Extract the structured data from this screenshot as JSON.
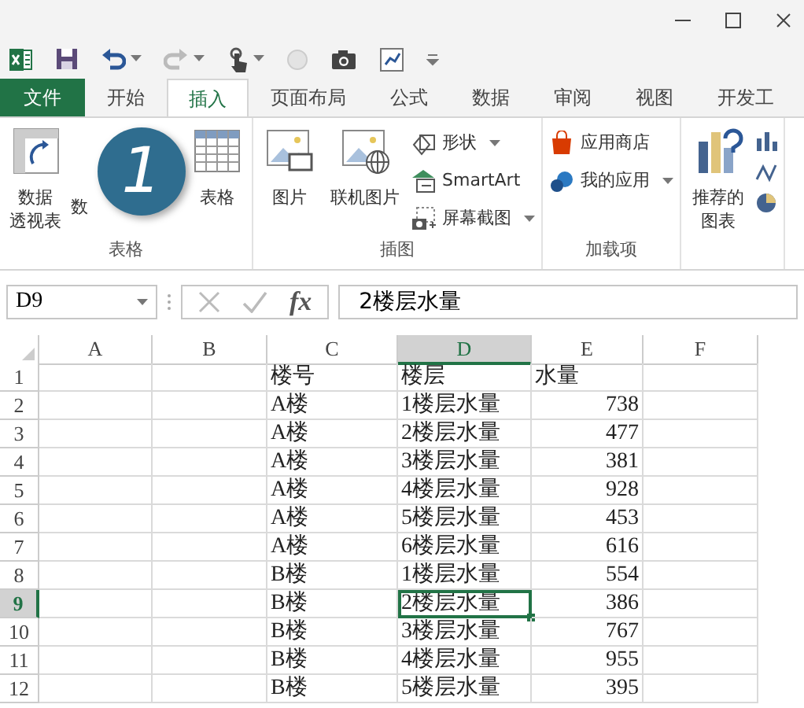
{
  "tabs": [
    {
      "label": "文件",
      "kind": "file",
      "selected": false
    },
    {
      "label": "开始",
      "kind": "tab",
      "selected": false
    },
    {
      "label": "插入",
      "kind": "tab",
      "selected": true
    },
    {
      "label": "页面布局",
      "kind": "tab",
      "selected": false
    },
    {
      "label": "公式",
      "kind": "tab",
      "selected": false
    },
    {
      "label": "数据",
      "kind": "tab",
      "selected": false
    },
    {
      "label": "审阅",
      "kind": "tab",
      "selected": false
    },
    {
      "label": "视图",
      "kind": "tab",
      "selected": false
    },
    {
      "label": "开发工",
      "kind": "tab",
      "selected": false
    }
  ],
  "ribbon": {
    "groups": [
      {
        "label": "表格",
        "items": [
          {
            "kind": "large",
            "lines": [
              "数据",
              "透视表"
            ]
          },
          {
            "kind": "large",
            "lines": [
              "数"
            ]
          },
          {
            "kind": "large",
            "lines": [
              "表格"
            ]
          }
        ]
      },
      {
        "label": "插图",
        "items": [
          {
            "kind": "large",
            "lines": [
              "图片"
            ]
          },
          {
            "kind": "large",
            "lines": [
              "联机图片"
            ]
          },
          {
            "kind": "stack",
            "items": [
              {
                "label": "形状",
                "dropdown": true
              },
              {
                "label": "SmartArt",
                "dropdown": false
              },
              {
                "label": "屏幕截图",
                "dropdown": true
              }
            ]
          }
        ]
      },
      {
        "label": "加载项",
        "items": [
          {
            "kind": "stack",
            "items": [
              {
                "label": "应用商店",
                "dropdown": false
              },
              {
                "label": "我的应用",
                "dropdown": true
              }
            ]
          }
        ]
      },
      {
        "items": [
          {
            "kind": "large",
            "lines": [
              "推荐的",
              "图表"
            ]
          },
          {
            "kind": "icons"
          }
        ]
      }
    ]
  },
  "callout": {
    "number": "1"
  },
  "formula_bar": {
    "name_box": "D9",
    "function_label": "fx",
    "value": "2楼层水量"
  },
  "sheet": {
    "columns": [
      {
        "label": "A",
        "selected": false
      },
      {
        "label": "B",
        "selected": false
      },
      {
        "label": "C",
        "selected": false
      },
      {
        "label": "D",
        "selected": true
      },
      {
        "label": "E",
        "selected": false
      },
      {
        "label": "F",
        "selected": false
      }
    ],
    "rows": [
      {
        "label": "1",
        "selected": false,
        "cells": [
          {
            "value": "楼号",
            "kind": "text",
            "selected": false
          },
          {
            "value": "楼层",
            "kind": "text",
            "selected": false
          },
          {
            "value": "水量",
            "kind": "text",
            "selected": false
          }
        ]
      },
      {
        "label": "2",
        "selected": false,
        "cells": [
          {
            "value": "A楼",
            "kind": "text",
            "selected": false
          },
          {
            "value": "1楼层水量",
            "kind": "text",
            "selected": false
          },
          {
            "value": "738",
            "kind": "number",
            "selected": false
          }
        ]
      },
      {
        "label": "3",
        "selected": false,
        "cells": [
          {
            "value": "A楼",
            "kind": "text",
            "selected": false
          },
          {
            "value": "2楼层水量",
            "kind": "text",
            "selected": false
          },
          {
            "value": "477",
            "kind": "number",
            "selected": false
          }
        ]
      },
      {
        "label": "4",
        "selected": false,
        "cells": [
          {
            "value": "A楼",
            "kind": "text",
            "selected": false
          },
          {
            "value": "3楼层水量",
            "kind": "text",
            "selected": false
          },
          {
            "value": "381",
            "kind": "number",
            "selected": false
          }
        ]
      },
      {
        "label": "5",
        "selected": false,
        "cells": [
          {
            "value": "A楼",
            "kind": "text",
            "selected": false
          },
          {
            "value": "4楼层水量",
            "kind": "text",
            "selected": false
          },
          {
            "value": "928",
            "kind": "number",
            "selected": false
          }
        ]
      },
      {
        "label": "6",
        "selected": false,
        "cells": [
          {
            "value": "A楼",
            "kind": "text",
            "selected": false
          },
          {
            "value": "5楼层水量",
            "kind": "text",
            "selected": false
          },
          {
            "value": "453",
            "kind": "number",
            "selected": false
          }
        ]
      },
      {
        "label": "7",
        "selected": false,
        "cells": [
          {
            "value": "A楼",
            "kind": "text",
            "selected": false
          },
          {
            "value": "6楼层水量",
            "kind": "text",
            "selected": false
          },
          {
            "value": "616",
            "kind": "number",
            "selected": false
          }
        ]
      },
      {
        "label": "8",
        "selected": false,
        "cells": [
          {
            "value": "B楼",
            "kind": "text",
            "selected": false
          },
          {
            "value": "1楼层水量",
            "kind": "text",
            "selected": false
          },
          {
            "value": "554",
            "kind": "number",
            "selected": false
          }
        ]
      },
      {
        "label": "9",
        "selected": true,
        "cells": [
          {
            "value": "B楼",
            "kind": "text",
            "selected": false
          },
          {
            "value": "2楼层水量",
            "kind": "text",
            "selected": true
          },
          {
            "value": "386",
            "kind": "number",
            "selected": false
          }
        ]
      },
      {
        "label": "10",
        "selected": false,
        "cells": [
          {
            "value": "B楼",
            "kind": "text",
            "selected": false
          },
          {
            "value": "3楼层水量",
            "kind": "text",
            "selected": false
          },
          {
            "value": "767",
            "kind": "number",
            "selected": false
          }
        ]
      },
      {
        "label": "11",
        "selected": false,
        "cells": [
          {
            "value": "B楼",
            "kind": "text",
            "selected": false
          },
          {
            "value": "4楼层水量",
            "kind": "text",
            "selected": false
          },
          {
            "value": "955",
            "kind": "number",
            "selected": false
          }
        ]
      },
      {
        "label": "12",
        "selected": false,
        "cells": [
          {
            "value": "B楼",
            "kind": "text",
            "selected": false
          },
          {
            "value": "5楼层水量",
            "kind": "text",
            "selected": false
          },
          {
            "value": "395",
            "kind": "number",
            "selected": false
          }
        ]
      }
    ]
  }
}
